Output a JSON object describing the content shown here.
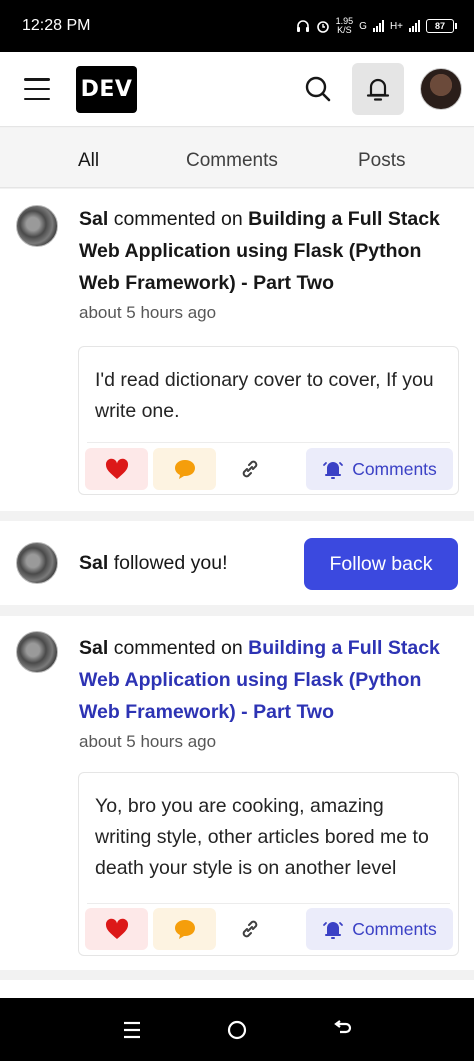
{
  "status_bar": {
    "time": "12:28 PM",
    "speed_value": "1.95",
    "speed_unit": "K/S",
    "network_1": "G",
    "network_2": "H+",
    "battery": "87"
  },
  "header": {
    "logo": "DEV"
  },
  "tabs": [
    "All",
    "Comments",
    "Posts"
  ],
  "notifications": [
    {
      "user": "Sal",
      "action": "commented on",
      "post_title": "Building a Full Stack Web Application using Flask (Python Web Framework) - Part Two",
      "time": "about 5 hours ago",
      "comment": "I'd read dictionary cover to cover, If you write one.",
      "subscribe_label": "Comments"
    },
    {
      "user": "Sal",
      "action": "followed you!",
      "button_label": "Follow back"
    },
    {
      "user": "Sal",
      "action": "commented on",
      "post_title": "Building a Full Stack Web Application using Flask (Python Web Framework) - Part Two",
      "time": "about 5 hours ago",
      "comment": "Yo, bro you are cooking, amazing writing style, other articles bored me to death your style is on another level",
      "subscribe_label": "Comments"
    }
  ],
  "colors": {
    "accent": "#3b49df",
    "link": "#2d33b4",
    "heart": "#dc1818",
    "comment_bubble": "#f59e0b"
  }
}
